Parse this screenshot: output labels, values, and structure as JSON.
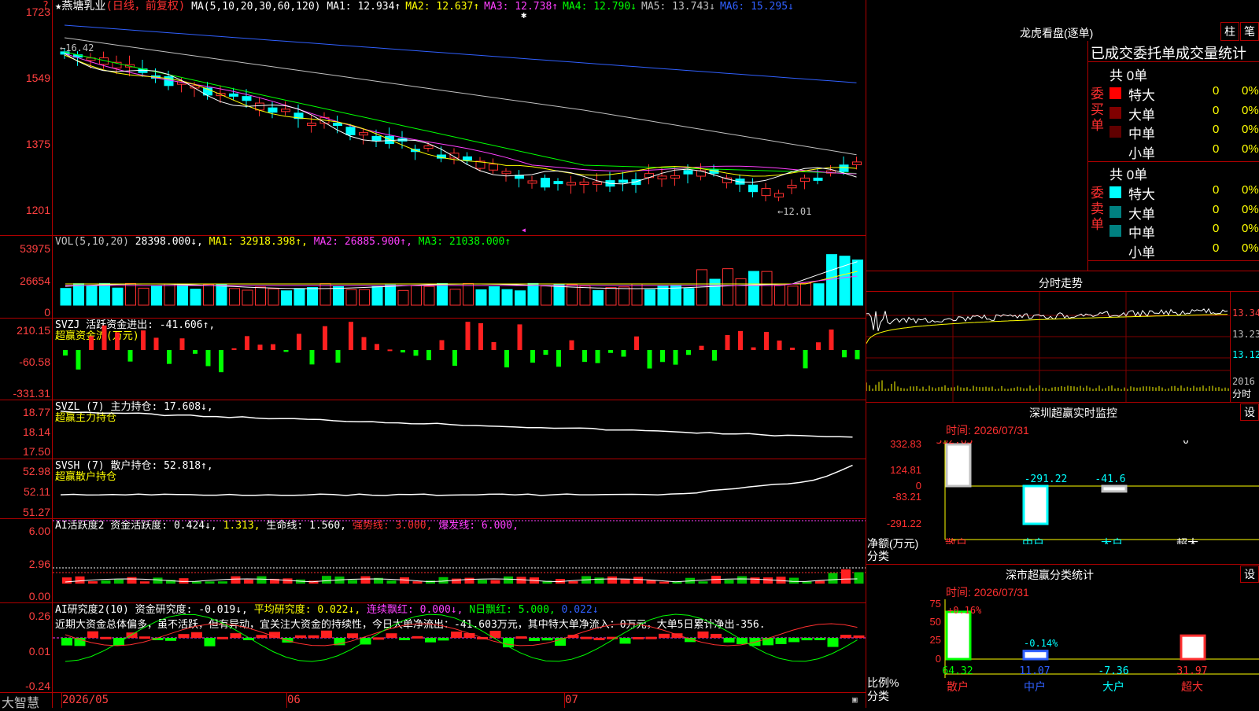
{
  "stock": {
    "name": "★燕塘乳业",
    "mode": "(日线，前复权)",
    "ma_label": "MA(5,10,20,30,60,120)",
    "ma_values": [
      {
        "label": "MA1:",
        "value": "12.934↑",
        "color": "#ffffff"
      },
      {
        "label": "MA2:",
        "value": "12.637↑",
        "color": "#ffff00"
      },
      {
        "label": "MA3:",
        "value": "12.738↑",
        "color": "#ff40ff"
      },
      {
        "label": "MA4:",
        "value": "12.790↓",
        "color": "#00ff00"
      },
      {
        "label": "MA5:",
        "value": "13.743↓",
        "color": "#c0c0c0"
      },
      {
        "label": "MA6:",
        "value": "15.295↓",
        "color": "#3060ff"
      }
    ],
    "high_marker": "←16.42",
    "low_marker": "←12.01"
  },
  "axes": {
    "price": [
      "1723",
      "1549",
      "1375",
      "1201"
    ],
    "vol": [
      "53975",
      "26654",
      "0"
    ],
    "svzj": [
      "210.15",
      "-60.58",
      "-331.31"
    ],
    "svzl": [
      "18.77",
      "18.14",
      "17.50"
    ],
    "svsh": [
      "52.98",
      "52.11",
      "51.27"
    ],
    "ai2": [
      "6.00",
      "2.96",
      "0.00"
    ],
    "ai3": [
      "0.26",
      "0.01",
      "-0.24"
    ]
  },
  "vol_panel": {
    "title": "VOL(5,10,20)",
    "value": "28398.000↓,",
    "ma1": "MA1: 32918.398↑,",
    "ma2": "MA2: 26885.900↑,",
    "ma3": "MA3: 21038.000↑"
  },
  "svzj_panel": {
    "title": "SVZJ  活跃资金进出: -41.606↑,",
    "subtitle": "超赢资金流(万元)"
  },
  "svzl_panel": {
    "title": "SVZL (7) 主力持仓: 17.608↓,",
    "subtitle": "超赢主力持仓"
  },
  "svsh_panel": {
    "title": "SVSH (7) 散户持仓: 52.818↑,",
    "subtitle": "超赢散户持仓"
  },
  "ai2_panel": {
    "title": "AI活跃度2 资金活跃度: 0.424↓, ",
    "v2": "1.313,",
    "v3": " 生命线: 1.560,",
    "v4": " 强势线: 3.000,",
    "v5": " 爆发线: 6.000,"
  },
  "ai3_panel": {
    "title": "AI研究度2(10) 资金研究度: -0.019↓,",
    "avg": " 平均研究度: 0.022↓,",
    "red": " 连续飘红: 0.000↓,",
    "nday": " N日飘红: 5.000,",
    "last": " 0.022↓",
    "comment": "近期大资金总体偏多，虽不活跃，但有异动，宜关注大资金的持续性，今日大单净流出：-41.603万元，其中特大单净流入：0万元，大单5日累计净出-356."
  },
  "xaxis": {
    "left_label": "大智慧",
    "dates": [
      "2026/05",
      "06",
      "07"
    ]
  },
  "longhu": {
    "title": "龙虎看盘(逐单)",
    "btn1": "柱",
    "btn2": "笔",
    "header": "已成交委托单成交量统计",
    "buy_label": "委买单",
    "sell_label": "委卖单",
    "buy_total": "共 0单",
    "sell_total": "共 0单",
    "buy_rows": [
      {
        "name": "特大",
        "count": "0",
        "pct": "0%",
        "color": "#ff0000"
      },
      {
        "name": "大单",
        "count": "0",
        "pct": "0%",
        "color": "#800000"
      },
      {
        "name": "中单",
        "count": "0",
        "pct": "0%",
        "color": "#600000"
      },
      {
        "name": "小单",
        "count": "0",
        "pct": "0%",
        "color": ""
      }
    ],
    "sell_rows": [
      {
        "name": "特大",
        "count": "0",
        "pct": "0%",
        "color": "#00ffff"
      },
      {
        "name": "大单",
        "count": "0",
        "pct": "0%",
        "color": "#008080"
      },
      {
        "name": "中单",
        "count": "0",
        "pct": "0%",
        "color": "#008080"
      },
      {
        "name": "小单",
        "count": "0",
        "pct": "0%",
        "color": ""
      }
    ]
  },
  "fenshi": {
    "title": "分时走势",
    "axis": [
      "13.34",
      "13.23",
      "13.12"
    ],
    "vol_label": "2016",
    "unit": "分时"
  },
  "monitor": {
    "title": "深圳超赢实时监控",
    "btn": "设",
    "time": "时间: 2026/07/31",
    "axis": [
      "332.83",
      "124.81",
      "0",
      "-83.21",
      "-291.22"
    ],
    "ylabel1": "净额(万元)",
    "ylabel2": "分类",
    "bar_values": [
      "332.83",
      "-291.22",
      "-41.6",
      "0"
    ],
    "cats": [
      "散户",
      "中户",
      "大户",
      "超大"
    ]
  },
  "classify": {
    "title": "深市超赢分类统计",
    "btn": "设",
    "time": "时间: 2026/07/31",
    "axis": [
      "75",
      "50",
      "25",
      "0"
    ],
    "top_labels": [
      "+0.16%",
      "-0.14%"
    ],
    "ylabel1": "比例%",
    "ylabel2": "分类",
    "values": [
      "64.32",
      "11.07",
      "-7.36",
      "31.97"
    ],
    "cats": [
      "散户",
      "中户",
      "大户",
      "超大"
    ]
  }
}
